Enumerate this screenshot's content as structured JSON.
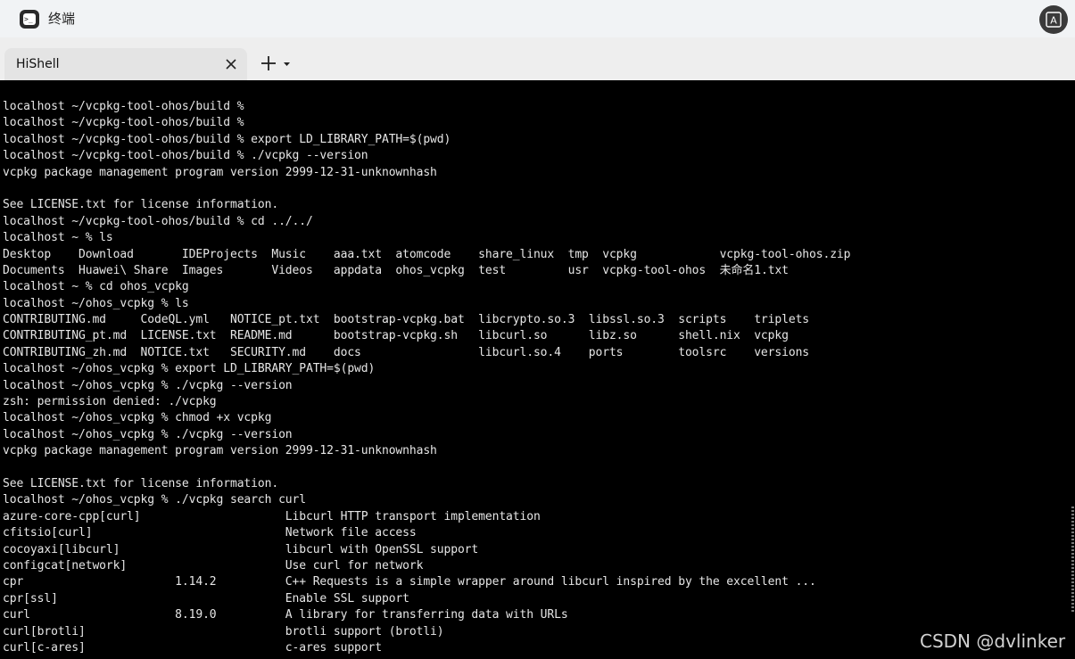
{
  "window": {
    "title": "终端",
    "app_icon_glyph": ">_",
    "translate_icon": "translate-icon"
  },
  "tabs": [
    {
      "label": "HiShell",
      "close_icon": "close-icon"
    }
  ],
  "new_tab": {
    "plus_icon": "plus-icon",
    "dropdown_icon": "chevron-down-icon"
  },
  "terminal": {
    "lines": [
      "localhost ~/vcpkg-tool-ohos/build %",
      "localhost ~/vcpkg-tool-ohos/build %",
      "localhost ~/vcpkg-tool-ohos/build % export LD_LIBRARY_PATH=$(pwd)",
      "localhost ~/vcpkg-tool-ohos/build % ./vcpkg --version",
      "vcpkg package management program version 2999-12-31-unknownhash",
      "",
      "See LICENSE.txt for license information.",
      "localhost ~/vcpkg-tool-ohos/build % cd ../../",
      "localhost ~ % ls",
      "Desktop    Download       IDEProjects  Music    aaa.txt  atomcode    share_linux  tmp  vcpkg            vcpkg-tool-ohos.zip",
      "Documents  Huawei\\ Share  Images       Videos   appdata  ohos_vcpkg  test         usr  vcpkg-tool-ohos  未命名1.txt",
      "localhost ~ % cd ohos_vcpkg",
      "localhost ~/ohos_vcpkg % ls",
      "CONTRIBUTING.md     CodeQL.yml   NOTICE_pt.txt  bootstrap-vcpkg.bat  libcrypto.so.3  libssl.so.3  scripts    triplets",
      "CONTRIBUTING_pt.md  LICENSE.txt  README.md      bootstrap-vcpkg.sh   libcurl.so      libz.so      shell.nix  vcpkg",
      "CONTRIBUTING_zh.md  NOTICE.txt   SECURITY.md    docs                 libcurl.so.4    ports        toolsrc    versions",
      "localhost ~/ohos_vcpkg % export LD_LIBRARY_PATH=$(pwd)",
      "localhost ~/ohos_vcpkg % ./vcpkg --version",
      "zsh: permission denied: ./vcpkg",
      "localhost ~/ohos_vcpkg % chmod +x vcpkg",
      "localhost ~/ohos_vcpkg % ./vcpkg --version",
      "vcpkg package management program version 2999-12-31-unknownhash",
      "",
      "See LICENSE.txt for license information.",
      "localhost ~/ohos_vcpkg % ./vcpkg search curl",
      "azure-core-cpp[curl]                     Libcurl HTTP transport implementation",
      "cfitsio[curl]                            Network file access",
      "cocoyaxi[libcurl]                        libcurl with OpenSSL support",
      "configcat[network]                       Use curl for network",
      "cpr                      1.14.2          C++ Requests is a simple wrapper around libcurl inspired by the excellent ...",
      "cpr[ssl]                                 Enable SSL support",
      "curl                     8.19.0          A library for transferring data with URLs",
      "curl[brotli]                             brotli support (brotli)",
      "curl[c-ares]                             c-ares support"
    ]
  },
  "watermark": "CSDN @dvlinker"
}
